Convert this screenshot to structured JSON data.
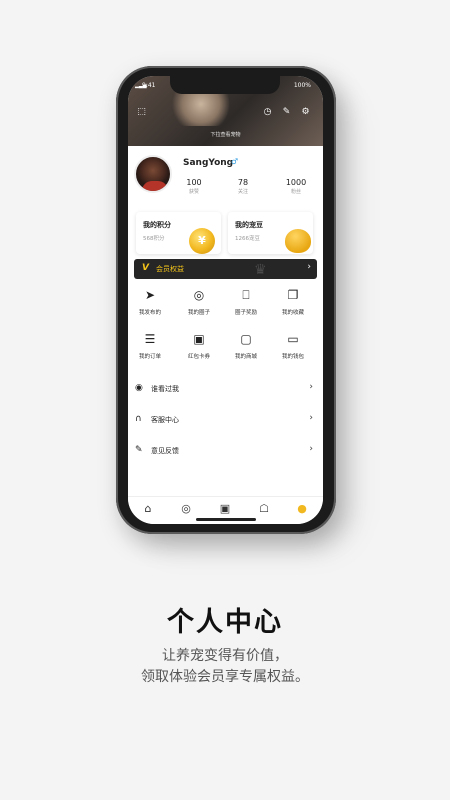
{
  "status_bar": {
    "signal": "▂▃▅",
    "time": "9:41",
    "battery": "100%"
  },
  "header": {
    "pull_hint": "下拉查看宠物",
    "icons": [
      "scan-icon",
      "clock-icon",
      "edit-icon",
      "settings-icon"
    ]
  },
  "profile": {
    "username": "SangYong",
    "gender_symbol": "♂",
    "stats": [
      {
        "value": "100",
        "label": "获赞"
      },
      {
        "value": "78",
        "label": "关注"
      },
      {
        "value": "1000",
        "label": "粉丝"
      }
    ]
  },
  "cards": [
    {
      "title": "我的积分",
      "sub": "568积分",
      "coin_symbol": "¥"
    },
    {
      "title": "我的宠豆",
      "sub": "1266宠豆"
    }
  ],
  "member": {
    "badge": "V",
    "label": "会员权益",
    "arrow": "›"
  },
  "grid": [
    {
      "label": "我发布的",
      "icon": "send-icon",
      "glyph": "➤"
    },
    {
      "label": "我的圈子",
      "icon": "circle-icon",
      "glyph": "◎"
    },
    {
      "label": "圈子奖励",
      "icon": "gift-icon",
      "glyph": "⎕"
    },
    {
      "label": "我的收藏",
      "icon": "bookmark-icon",
      "glyph": "❐"
    },
    {
      "label": "我的订单",
      "icon": "order-icon",
      "glyph": "☰"
    },
    {
      "label": "红包卡券",
      "icon": "coupon-icon",
      "glyph": "▣"
    },
    {
      "label": "我的商城",
      "icon": "shop-bag-icon",
      "glyph": "▢"
    },
    {
      "label": "我的钱包",
      "icon": "wallet-icon",
      "glyph": "▭"
    }
  ],
  "list": [
    {
      "label": "谁看过我",
      "icon": "eye-icon",
      "glyph": "◉",
      "arrow": "›"
    },
    {
      "label": "客服中心",
      "icon": "headset-icon",
      "glyph": "∩",
      "arrow": "›"
    },
    {
      "label": "意见反馈",
      "icon": "pencil-icon",
      "glyph": "✎",
      "arrow": "›"
    }
  ],
  "tabbar": [
    {
      "icon": "home-icon",
      "glyph": "⌂"
    },
    {
      "icon": "discover-icon",
      "glyph": "◎"
    },
    {
      "icon": "camera-icon",
      "glyph": "▣"
    },
    {
      "icon": "store-icon",
      "glyph": "☖"
    },
    {
      "icon": "profile-icon",
      "glyph": "●"
    }
  ],
  "caption": {
    "title": "个人中心",
    "line1": "让养宠变得有价值，",
    "line2": "领取体验会员享专属权益。"
  },
  "colors": {
    "accent": "#f2b81f",
    "member_bar": "#262626"
  }
}
